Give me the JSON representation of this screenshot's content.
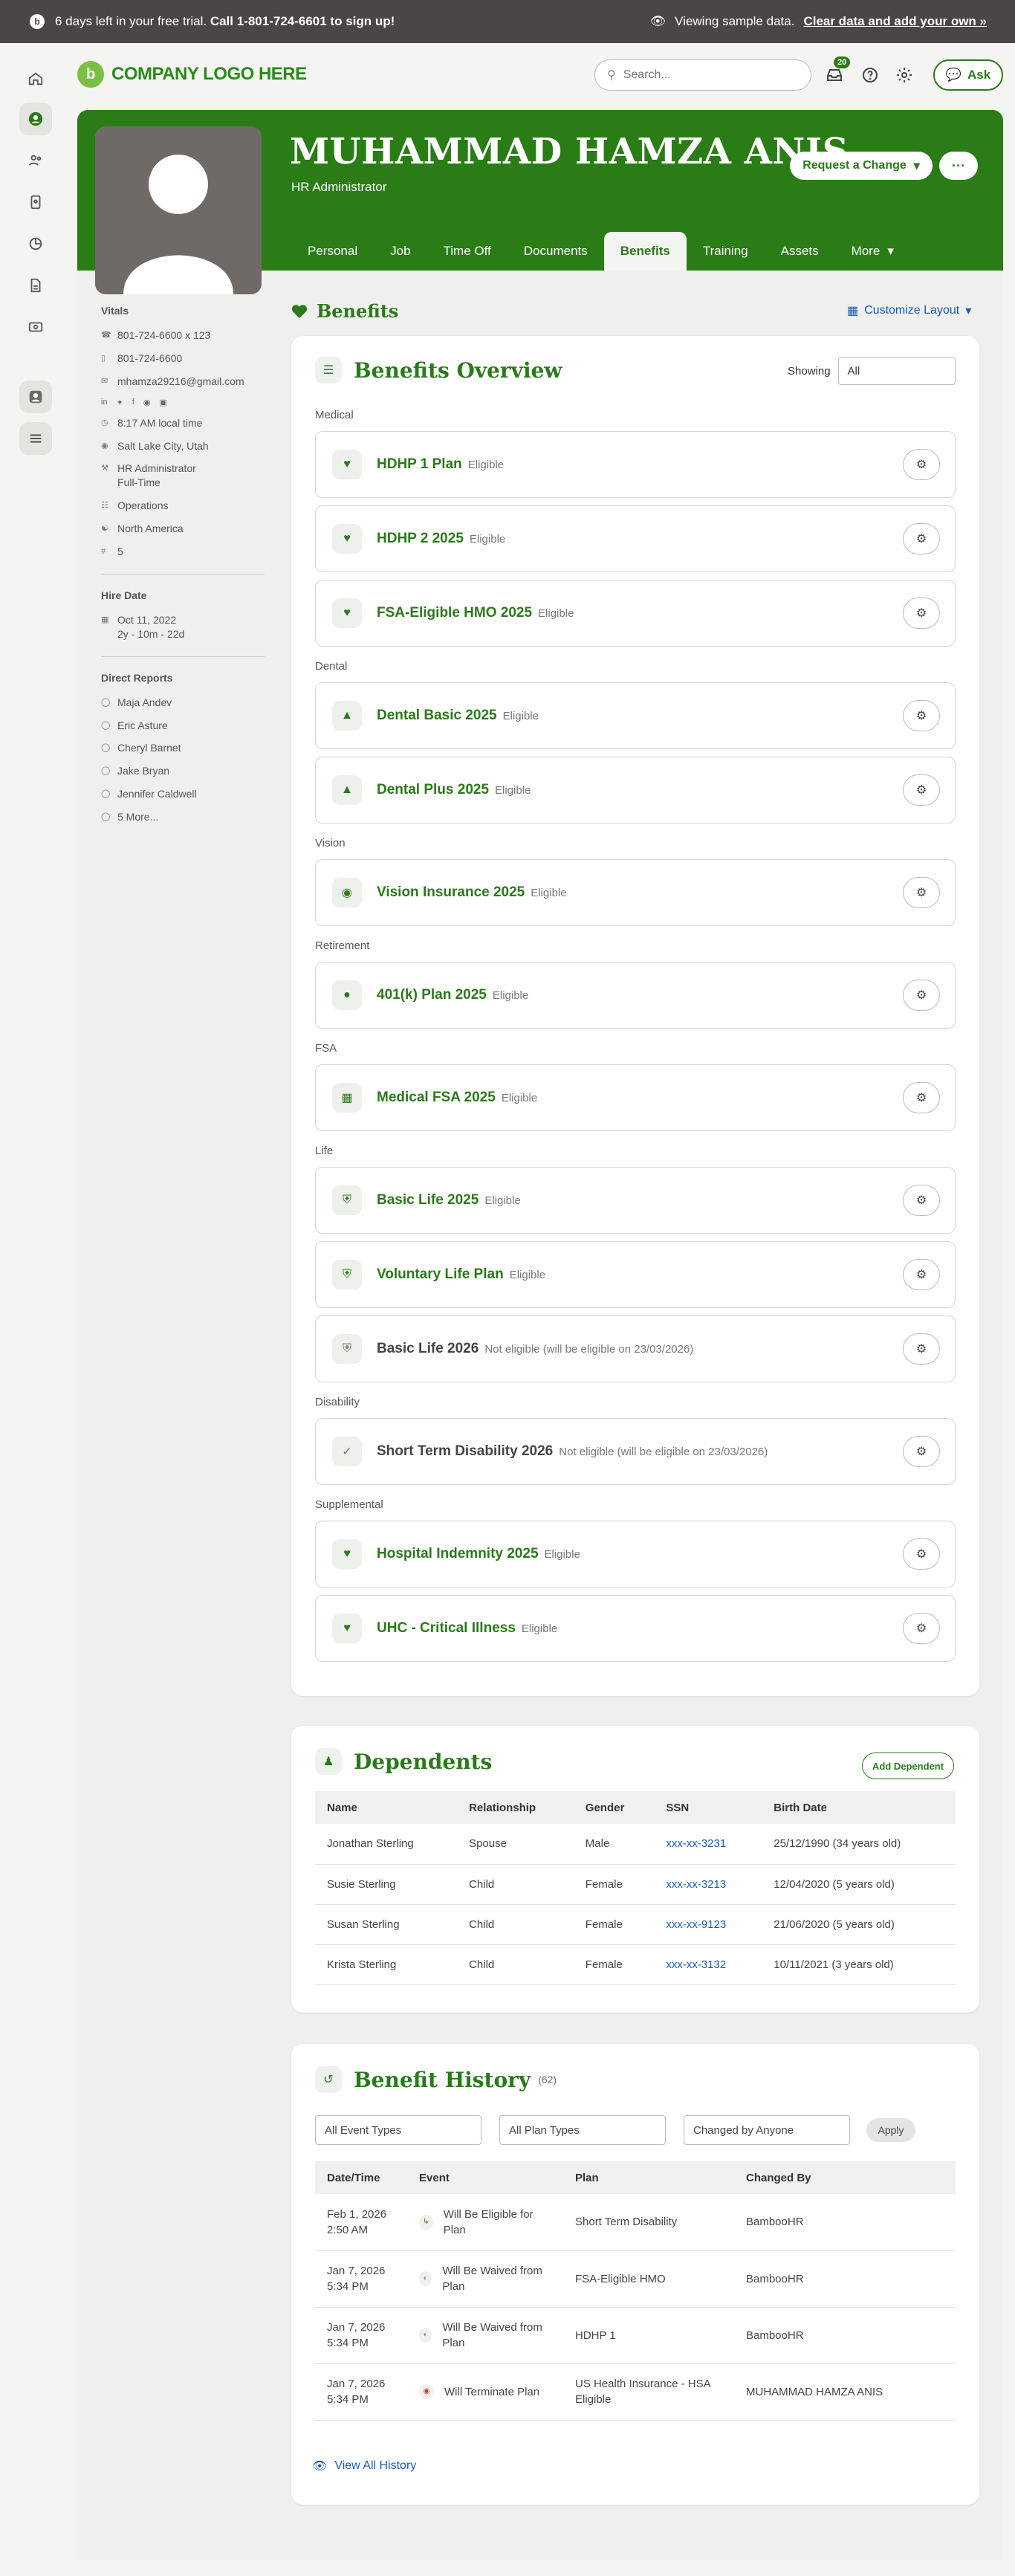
{
  "banner": {
    "trial": "6 days left in your free trial.",
    "call": "Call 1-801-724-6601 to sign up!",
    "sample": "Viewing sample data.",
    "clear": "Clear data and add your own »"
  },
  "top": {
    "logo": "COMPANY LOGO HERE",
    "search_placeholder": "Search...",
    "notif_count": "20",
    "ask": "Ask"
  },
  "profile": {
    "name": "MUHAMMAD HAMZA ANIS",
    "title": "HR Administrator",
    "request": "Request a Change",
    "more": "···"
  },
  "tabs": [
    "Personal",
    "Job",
    "Time Off",
    "Documents",
    "Benefits",
    "Training",
    "Assets",
    "More"
  ],
  "vitals": {
    "heading": "Vitals",
    "work_phone": "801-724-6600 x 123",
    "mobile": "801-724-6600",
    "email": "mhamza29216@gmail.com",
    "local_time": "8:17 AM local time",
    "location": "Salt Lake City, Utah",
    "job_title": "HR Administrator",
    "job_type": "Full-Time",
    "department": "Operations",
    "region": "North America",
    "number": "5",
    "hire_heading": "Hire Date",
    "hire_date": "Oct 11, 2022",
    "tenure": "2y - 10m - 22d",
    "reports_heading": "Direct Reports",
    "reports": [
      "Maja Andev",
      "Eric Asture",
      "Cheryl Barnet",
      "Jake Bryan",
      "Jennifer Caldwell"
    ],
    "more_reports": "5 More..."
  },
  "benefits": {
    "heading": "Benefits",
    "customize": "Customize Layout",
    "overview": "Benefits Overview",
    "showing": "Showing",
    "filter": "All",
    "groups": [
      {
        "cat": "Medical",
        "plans": [
          {
            "name": "HDHP 1 Plan",
            "status": "Eligible"
          },
          {
            "name": "HDHP 2 2025",
            "status": "Eligible"
          },
          {
            "name": "FSA-Eligible HMO 2025",
            "status": "Eligible"
          }
        ]
      },
      {
        "cat": "Dental",
        "plans": [
          {
            "name": "Dental Basic 2025",
            "status": "Eligible"
          },
          {
            "name": "Dental Plus 2025",
            "status": "Eligible"
          }
        ]
      },
      {
        "cat": "Vision",
        "plans": [
          {
            "name": "Vision Insurance 2025",
            "status": "Eligible"
          }
        ]
      },
      {
        "cat": "Retirement",
        "plans": [
          {
            "name": "401(k) Plan 2025",
            "status": "Eligible"
          }
        ]
      },
      {
        "cat": "FSA",
        "plans": [
          {
            "name": "Medical FSA 2025",
            "status": "Eligible"
          }
        ]
      },
      {
        "cat": "Life",
        "plans": [
          {
            "name": "Basic Life 2025",
            "status": "Eligible"
          },
          {
            "name": "Voluntary Life Plan",
            "status": "Eligible"
          },
          {
            "name": "Basic Life 2026",
            "status": "Not eligible (will be eligible on 23/03/2026)"
          }
        ]
      },
      {
        "cat": "Disability",
        "plans": [
          {
            "name": "Short Term Disability 2026",
            "status": "Not eligible (will be eligible on 23/03/2026)"
          }
        ]
      },
      {
        "cat": "Supplemental",
        "plans": [
          {
            "name": "Hospital Indemnity 2025",
            "status": "Eligible"
          },
          {
            "name": "UHC - Critical Illness",
            "status": "Eligible"
          }
        ]
      }
    ]
  },
  "dependents": {
    "heading": "Dependents",
    "add": "Add Dependent",
    "cols": [
      "Name",
      "Relationship",
      "Gender",
      "SSN",
      "Birth Date"
    ],
    "rows": [
      [
        "Jonathan Sterling",
        "Spouse",
        "Male",
        "xxx-xx-3231",
        "25/12/1990 (34 years old)"
      ],
      [
        "Susie Sterling",
        "Child",
        "Female",
        "xxx-xx-3213",
        "12/04/2020 (5 years old)"
      ],
      [
        "Susan Sterling",
        "Child",
        "Female",
        "xxx-xx-9123",
        "21/06/2020 (5 years old)"
      ],
      [
        "Krista Sterling",
        "Child",
        "Female",
        "xxx-xx-3132",
        "10/11/2021 (3 years old)"
      ]
    ]
  },
  "history": {
    "heading": "Benefit History",
    "count": "(62)",
    "f1": "All Event Types",
    "f2": "All Plan Types",
    "f3": "Changed by Anyone",
    "apply": "Apply",
    "cols": [
      "Date/Time",
      "Event",
      "Plan",
      "Changed By"
    ],
    "rows": [
      [
        "Feb 1, 2026",
        "2:50 AM",
        "Will Be Eligible for Plan",
        "Short Term Disability",
        "BambooHR"
      ],
      [
        "Jan 7, 2026",
        "5:34 PM",
        "Will Be Waived from Plan",
        "FSA-Eligible HMO",
        "BambooHR"
      ],
      [
        "Jan 7, 2026",
        "5:34 PM",
        "Will Be Waived from Plan",
        "HDHP 1",
        "BambooHR"
      ],
      [
        "Jan 7, 2026",
        "5:34 PM",
        "Will Terminate Plan",
        "US Health Insurance - HSA Eligible",
        "MUHAMMAD HAMZA ANIS"
      ]
    ],
    "view_all": "View All History"
  }
}
